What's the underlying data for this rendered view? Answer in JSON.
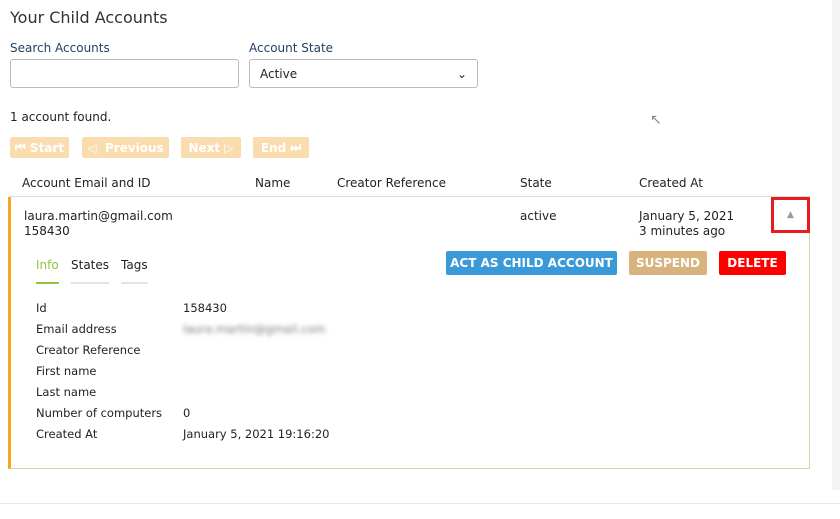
{
  "title": "Your Child Accounts",
  "search": {
    "label": "Search Accounts",
    "value": ""
  },
  "state": {
    "label": "Account State",
    "value": "Active"
  },
  "count": "1 account found.",
  "pager": {
    "start": "Start",
    "previous": "Previous",
    "next": "Next",
    "end": "End"
  },
  "columns": [
    "Account Email and ID",
    "Name",
    "Creator Reference",
    "State",
    "Created At"
  ],
  "row": {
    "email": "laura.martin@gmail.com",
    "id": "158430",
    "state": "active",
    "created": "January 5, 2021",
    "created_rel": "3 minutes ago"
  },
  "tabs": [
    "Info",
    "States",
    "Tags"
  ],
  "actions": {
    "act": "ACT AS CHILD ACCOUNT",
    "suspend": "SUSPEND",
    "delete": "DELETE"
  },
  "info": [
    {
      "label": "Id",
      "value": "158430"
    },
    {
      "label": "Email address",
      "value": "laura.martin@gmail.com"
    },
    {
      "label": "Creator Reference",
      "value": ""
    },
    {
      "label": "First name",
      "value": ""
    },
    {
      "label": "Last name",
      "value": ""
    },
    {
      "label": "Number of computers",
      "value": "0"
    },
    {
      "label": "Created At",
      "value": "January 5, 2021 19:16:20"
    }
  ],
  "colors": {
    "accent": "#f5a623",
    "tab_active": "#8cc63f",
    "act": "#3a9ad9",
    "suspend": "#d9b37e",
    "delete": "#ff0000"
  }
}
